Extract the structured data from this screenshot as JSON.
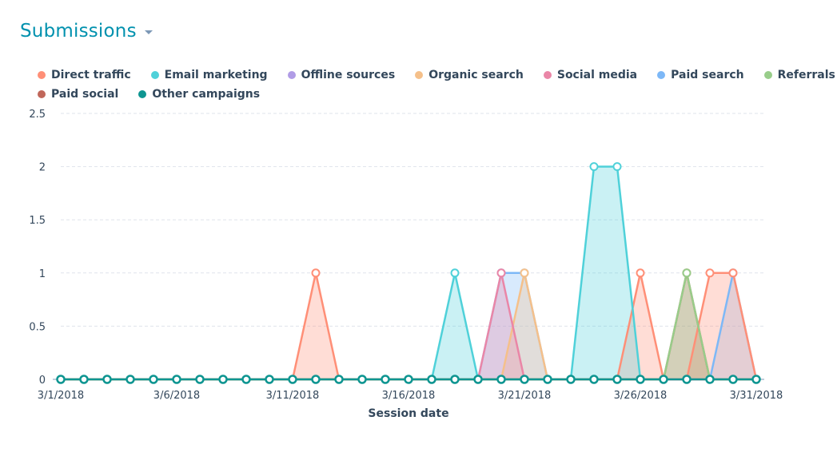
{
  "header": {
    "title": "Submissions",
    "dropdown_icon": "caret-down-icon"
  },
  "colors": {
    "Direct traffic": "#ff8f77",
    "Email marketing": "#4fd1d9",
    "Offline sources": "#b09ce6",
    "Organic search": "#f5c08a",
    "Social media": "#ea86a7",
    "Paid search": "#7db8f7",
    "Referrals": "#98cd8a",
    "Paid social": "#c0675a",
    "Other campaigns": "#0e9591"
  },
  "legend_rows": [
    [
      "Direct traffic",
      "Email marketing",
      "Offline sources",
      "Organic search",
      "Social media",
      "Paid search",
      "Referrals"
    ],
    [
      "Paid social",
      "Other campaigns"
    ]
  ],
  "chart_data": {
    "type": "area",
    "title": "Submissions",
    "xlabel": "Session date",
    "ylabel": "",
    "ylim": [
      0,
      2.5
    ],
    "yticks": [
      "0",
      "0.5",
      "1",
      "1.5",
      "2",
      "2.5"
    ],
    "ytick_values": [
      0,
      0.5,
      1,
      1.5,
      2,
      2.5
    ],
    "xtick_labels": [
      "3/1/2018",
      "3/6/2018",
      "3/11/2018",
      "3/16/2018",
      "3/21/2018",
      "3/26/2018",
      "3/31/2018"
    ],
    "xtick_indices": [
      0,
      5,
      10,
      15,
      20,
      25,
      30
    ],
    "grid": true,
    "legend_position": "top-left",
    "x": [
      "3/1/2018",
      "3/2/2018",
      "3/3/2018",
      "3/4/2018",
      "3/5/2018",
      "3/6/2018",
      "3/7/2018",
      "3/8/2018",
      "3/9/2018",
      "3/10/2018",
      "3/11/2018",
      "3/12/2018",
      "3/13/2018",
      "3/14/2018",
      "3/15/2018",
      "3/16/2018",
      "3/17/2018",
      "3/18/2018",
      "3/19/2018",
      "3/20/2018",
      "3/21/2018",
      "3/22/2018",
      "3/23/2018",
      "3/24/2018",
      "3/25/2018",
      "3/26/2018",
      "3/27/2018",
      "3/28/2018",
      "3/29/2018",
      "3/30/2018",
      "3/31/2018"
    ],
    "series": [
      {
        "name": "Paid search",
        "values": [
          0,
          0,
          0,
          0,
          0,
          0,
          0,
          0,
          0,
          0,
          0,
          0,
          0,
          0,
          0,
          0,
          0,
          0,
          0,
          1,
          1,
          0,
          0,
          0,
          0,
          0,
          0,
          0,
          0,
          1,
          0
        ]
      },
      {
        "name": "Direct traffic",
        "values": [
          0,
          0,
          0,
          0,
          0,
          0,
          0,
          0,
          0,
          0,
          0,
          1,
          0,
          0,
          0,
          0,
          0,
          0,
          0,
          0,
          0,
          0,
          0,
          0,
          0,
          1,
          0,
          0,
          1,
          1,
          0
        ]
      },
      {
        "name": "Email marketing",
        "values": [
          0,
          0,
          0,
          0,
          0,
          0,
          0,
          0,
          0,
          0,
          0,
          0,
          0,
          0,
          0,
          0,
          0,
          1,
          0,
          0,
          0,
          0,
          0,
          2,
          2,
          0,
          0,
          0,
          0,
          0,
          0
        ]
      },
      {
        "name": "Offline sources",
        "values": [
          0,
          0,
          0,
          0,
          0,
          0,
          0,
          0,
          0,
          0,
          0,
          0,
          0,
          0,
          0,
          0,
          0,
          0,
          0,
          0,
          0,
          0,
          0,
          0,
          0,
          0,
          0,
          0,
          0,
          0,
          0
        ]
      },
      {
        "name": "Organic search",
        "values": [
          0,
          0,
          0,
          0,
          0,
          0,
          0,
          0,
          0,
          0,
          0,
          0,
          0,
          0,
          0,
          0,
          0,
          0,
          0,
          0,
          1,
          0,
          0,
          0,
          0,
          0,
          0,
          0,
          0,
          0,
          0
        ]
      },
      {
        "name": "Social media",
        "values": [
          0,
          0,
          0,
          0,
          0,
          0,
          0,
          0,
          0,
          0,
          0,
          0,
          0,
          0,
          0,
          0,
          0,
          0,
          0,
          1,
          0,
          0,
          0,
          0,
          0,
          0,
          0,
          0,
          0,
          0,
          0
        ]
      },
      {
        "name": "Paid social",
        "values": [
          0,
          0,
          0,
          0,
          0,
          0,
          0,
          0,
          0,
          0,
          0,
          0,
          0,
          0,
          0,
          0,
          0,
          0,
          0,
          0,
          0,
          0,
          0,
          0,
          0,
          0,
          0,
          1,
          0,
          0,
          0
        ]
      },
      {
        "name": "Referrals",
        "values": [
          0,
          0,
          0,
          0,
          0,
          0,
          0,
          0,
          0,
          0,
          0,
          0,
          0,
          0,
          0,
          0,
          0,
          0,
          0,
          0,
          0,
          0,
          0,
          0,
          0,
          0,
          0,
          1,
          0,
          0,
          0
        ]
      },
      {
        "name": "Other campaigns",
        "values": [
          0,
          0,
          0,
          0,
          0,
          0,
          0,
          0,
          0,
          0,
          0,
          0,
          0,
          0,
          0,
          0,
          0,
          0,
          0,
          0,
          0,
          0,
          0,
          0,
          0,
          0,
          0,
          0,
          0,
          0,
          0
        ]
      }
    ]
  }
}
